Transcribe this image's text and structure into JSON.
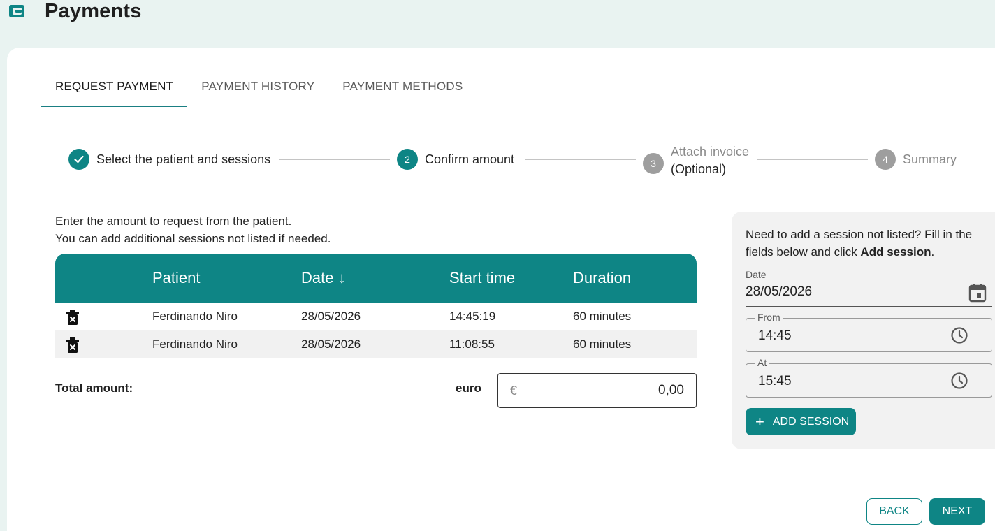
{
  "header": {
    "title": "Payments",
    "icon": "wallet-icon"
  },
  "tabs": [
    {
      "label": "REQUEST PAYMENT",
      "active": true
    },
    {
      "label": "PAYMENT HISTORY",
      "active": false
    },
    {
      "label": "PAYMENT METHODS",
      "active": false
    }
  ],
  "stepper": {
    "steps": [
      {
        "number": "",
        "label": "Select the patient and sessions",
        "state": "completed"
      },
      {
        "number": "2",
        "label": "Confirm amount",
        "state": "active"
      },
      {
        "number": "3",
        "label": "Attach invoice",
        "sublabel": "(Optional)",
        "state": "inactive"
      },
      {
        "number": "4",
        "label": "Summary",
        "state": "inactive"
      }
    ]
  },
  "intro": {
    "line1": "Enter the amount to request from the patient.",
    "line2": "You can add additional sessions not listed if needed."
  },
  "table": {
    "columns": [
      "Patient",
      "Date ↓",
      "Start time",
      "Duration"
    ],
    "rows": [
      {
        "patient": "Ferdinando Niro",
        "date": "28/05/2026",
        "start": "14:45:19",
        "duration": "60 minutes"
      },
      {
        "patient": "Ferdinando Niro",
        "date": "28/05/2026",
        "start": "11:08:55",
        "duration": "60 minutes"
      }
    ]
  },
  "total": {
    "label": "Total amount:",
    "currency": "euro",
    "prefix": "€",
    "value": "0,00"
  },
  "side": {
    "help_pre": "Need to add a session not listed? Fill in the fields below and click ",
    "help_bold": "Add session",
    "help_post": ".",
    "date_label": "Date",
    "date_value": "28/05/2026",
    "from_label": "From",
    "from_value": "14:45",
    "at_label": "At",
    "at_value": "15:45",
    "add_button": "ADD SESSION"
  },
  "footer": {
    "back": "BACK",
    "next": "NEXT"
  },
  "colors": {
    "accent": "#0e8585",
    "background": "#e9f3f1",
    "inactive": "#9e9e9e"
  }
}
